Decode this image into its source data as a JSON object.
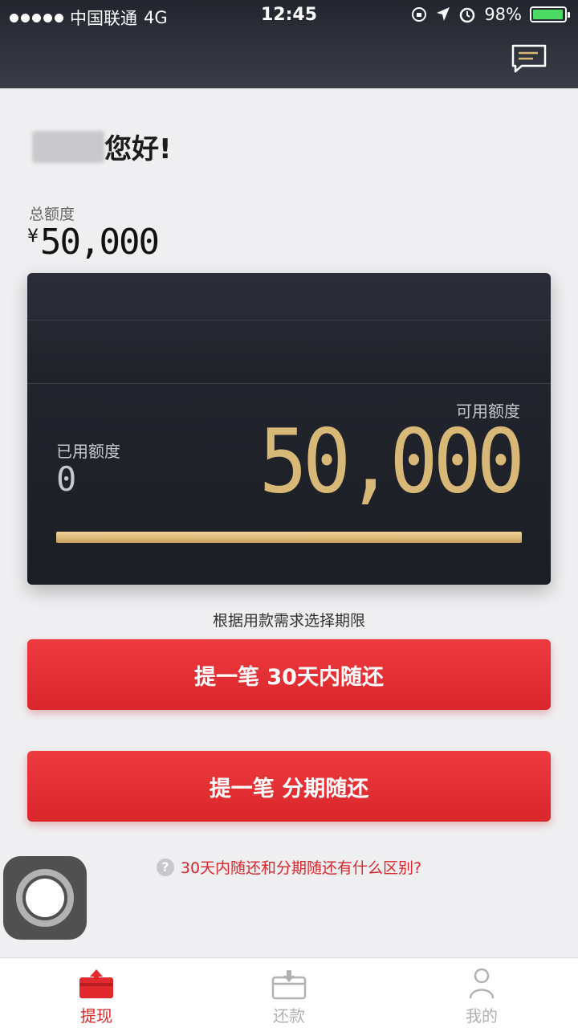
{
  "status_bar": {
    "carrier": "中国联通",
    "network": "4G",
    "time": "12:45",
    "battery": "98%",
    "battery_level": 0.98
  },
  "greeting": {
    "text": "您好!"
  },
  "total": {
    "label": "总额度",
    "currency": "¥",
    "amount": "50,000"
  },
  "card": {
    "available_label": "可用额度",
    "available_amount": "50,000",
    "used_label": "已用额度",
    "used_amount": "0",
    "progress_fraction": 1.0
  },
  "hint": "根据用款需求选择期限",
  "buttons": {
    "thirty_days": "提一笔 30天内随还",
    "installment": "提一笔 分期随还"
  },
  "faq": {
    "icon_text": "?",
    "text": "30天内随还和分期随还有什么区别?"
  },
  "tabs": [
    {
      "label": "提现",
      "icon": "withdraw-icon",
      "active": true
    },
    {
      "label": "还款",
      "icon": "repay-icon",
      "active": false
    },
    {
      "label": "我的",
      "icon": "profile-icon",
      "active": false
    }
  ],
  "colors": {
    "accent": "#d9262b",
    "gold": "#d8b877",
    "header": "#2a2c35"
  }
}
